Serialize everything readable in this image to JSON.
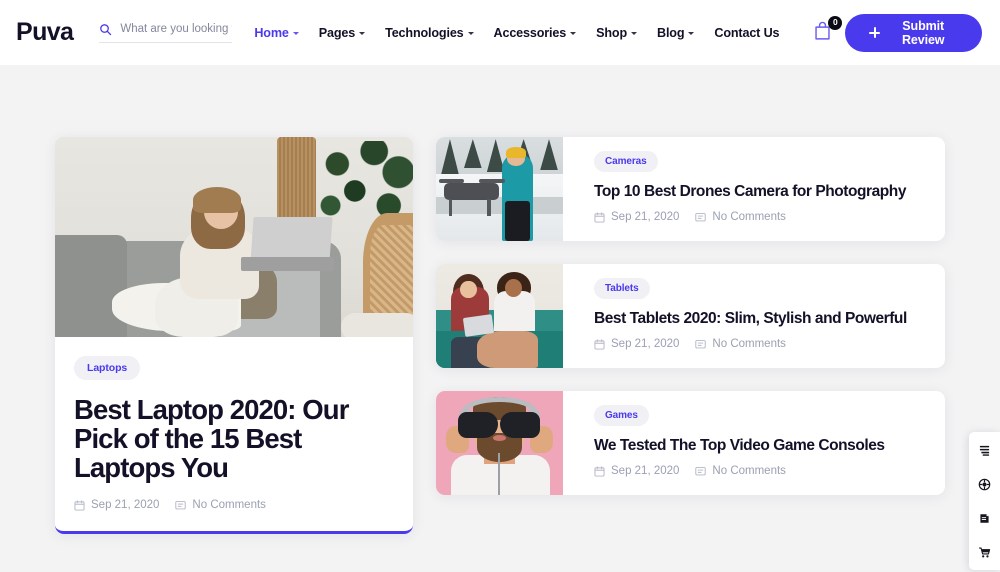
{
  "header": {
    "logo": "Puva",
    "search": {
      "placeholder": "What are you looking for?",
      "value": "",
      "icon": "search-icon"
    },
    "nav": [
      {
        "label": "Home",
        "has_caret": true,
        "active": true
      },
      {
        "label": "Pages",
        "has_caret": true,
        "active": false
      },
      {
        "label": "Technologies",
        "has_caret": true,
        "active": false
      },
      {
        "label": "Accessories",
        "has_caret": true,
        "active": false
      },
      {
        "label": "Shop",
        "has_caret": true,
        "active": false
      },
      {
        "label": "Blog",
        "has_caret": true,
        "active": false
      },
      {
        "label": "Contact Us",
        "has_caret": false,
        "active": false
      }
    ],
    "cart": {
      "icon": "shopping-bag-icon",
      "count": "0"
    },
    "submit_button": {
      "label": "Submit Review",
      "icon": "plus-icon"
    }
  },
  "featured": {
    "category": "Laptops",
    "title": "Best Laptop 2020: Our Pick of the 15 Best Laptops You",
    "date": "Sep 21, 2020",
    "comments": "No Comments",
    "image_alt": "Woman sitting on a gray sofa using a laptop beside a plant"
  },
  "posts": [
    {
      "category": "Cameras",
      "title": "Top 10 Best Drones Camera for Photography",
      "date": "Sep 21, 2020",
      "comments": "No Comments",
      "image_alt": "Person in teal jacket flying a drone in a snowy landscape",
      "scene": "drone"
    },
    {
      "category": "Tablets",
      "title": "Best Tablets 2020: Slim, Stylish and Powerful",
      "date": "Sep 21, 2020",
      "comments": "No Comments",
      "image_alt": "Two friends sitting on a teal couch looking at a tablet",
      "scene": "tablet"
    },
    {
      "category": "Games",
      "title": "We Tested The Top Video Game Consoles",
      "date": "Sep 21, 2020",
      "comments": "No Comments",
      "image_alt": "Bearded man holding two game controllers over his eyes on pink background",
      "scene": "games"
    }
  ],
  "dock": [
    {
      "icon": "layers-icon",
      "label": "Layouts"
    },
    {
      "icon": "life-ring-icon",
      "label": "Support"
    },
    {
      "icon": "book-icon",
      "label": "Documentation"
    },
    {
      "icon": "cart-icon",
      "label": "Cart"
    }
  ],
  "colors": {
    "accent": "#4a3aed",
    "text": "#121127",
    "muted": "#9ba0b2",
    "page_bg": "#f3f3f4",
    "badge_bg": "#f0f0f5"
  }
}
